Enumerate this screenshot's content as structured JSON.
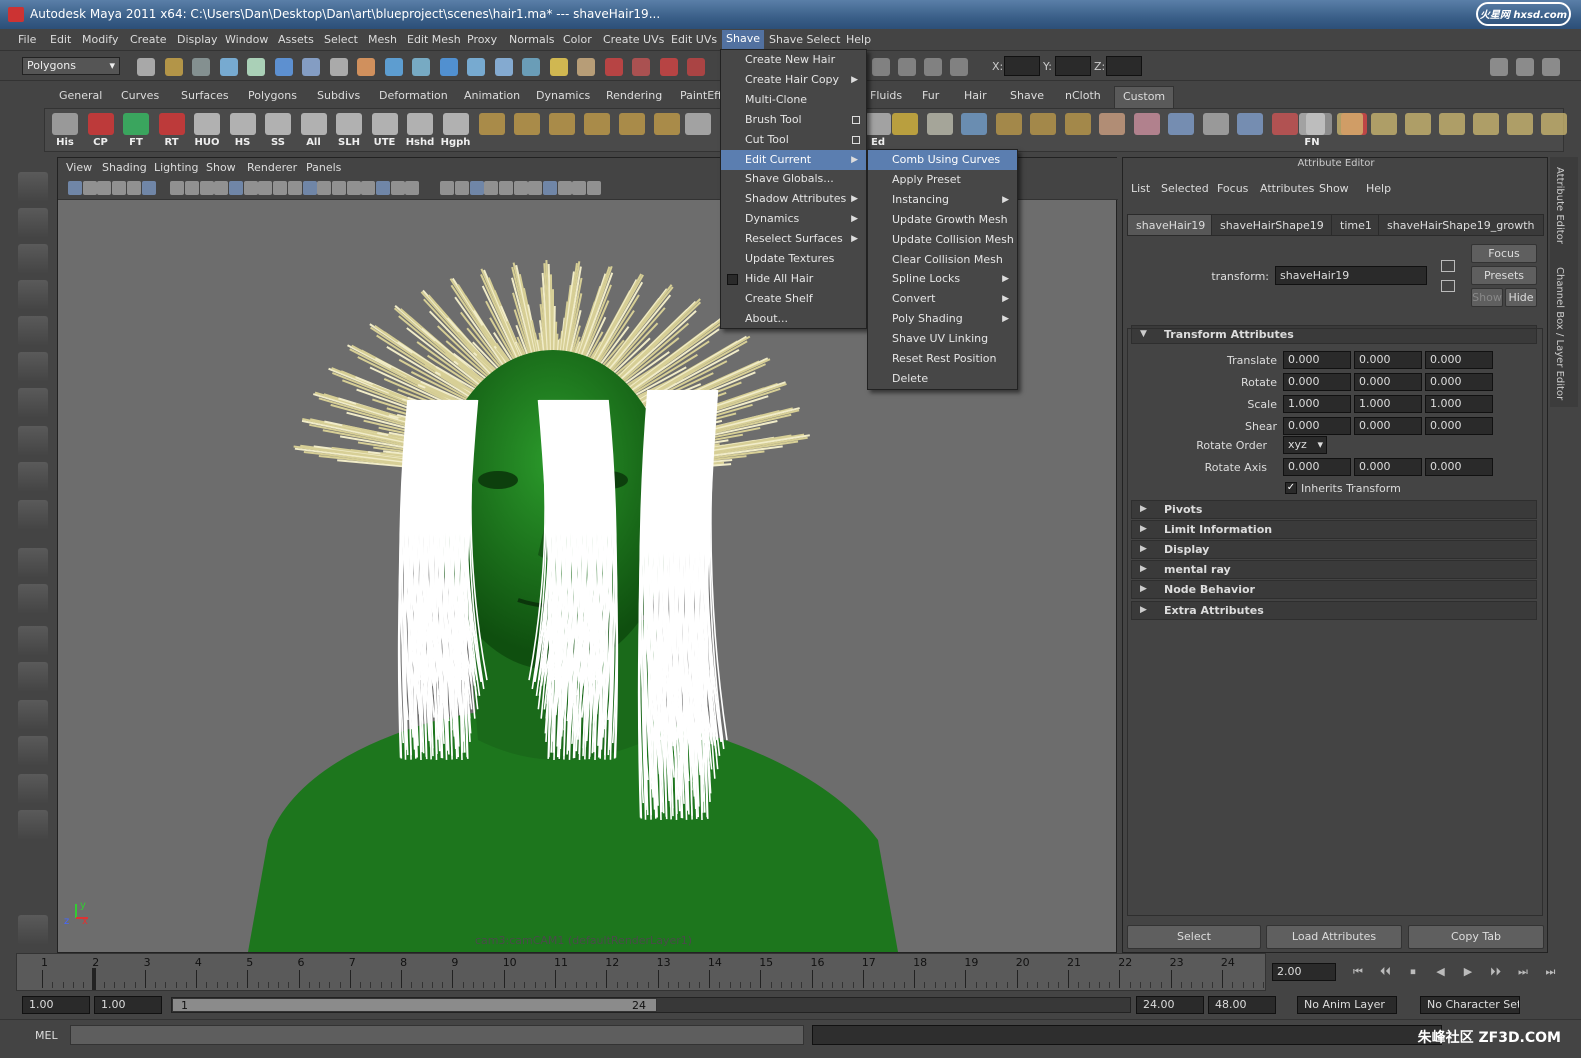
{
  "window": {
    "title": "Autodesk Maya 2011 x64: C:\\Users\\Dan\\Desktop\\Dan\\art\\blueproject\\scenes\\hair1.ma*   ---   shaveHair19...",
    "watermark_top": "火星网 hxsd.com"
  },
  "menubar": [
    "File",
    "Edit",
    "Modify",
    "Create",
    "Display",
    "Window",
    "Assets",
    "Select",
    "Mesh",
    "Edit Mesh",
    "Proxy",
    "Normals",
    "Color",
    "Create UVs",
    "Edit UVs",
    "Shave",
    "Shave Select",
    "Help"
  ],
  "statusline": {
    "menu_set": "Polygons",
    "x_label": "X:",
    "y_label": "Y:",
    "z_label": "Z:"
  },
  "shelf_tabs": [
    "General",
    "Curves",
    "Surfaces",
    "Polygons",
    "Subdivs",
    "Deformation",
    "Animation",
    "Dynamics",
    "Rendering",
    "PaintEff",
    "Fluids",
    "Fur",
    "Hair",
    "Shave",
    "nCloth",
    "Custom"
  ],
  "shelf_buttons": [
    "His",
    "CP",
    "FT",
    "RT",
    "HUO",
    "HS",
    "SS",
    "All",
    "SLH",
    "UTE",
    "Hshd",
    "Hgph"
  ],
  "shelf_right_labels": [
    "Ed",
    "FN"
  ],
  "viewport": {
    "menus": [
      "View",
      "Shading",
      "Lighting",
      "Show",
      "Renderer",
      "Panels"
    ],
    "camera_label": "cam3:camCAM1 (defaultRenderLayer1)",
    "axis_y": "y",
    "axis_z": "z",
    "axis_x": "x"
  },
  "shave_menu": [
    {
      "label": "Create New Hair"
    },
    {
      "label": "Create Hair Copy",
      "arrow": true
    },
    {
      "label": "Multi-Clone"
    },
    {
      "label": "Brush Tool",
      "box": true
    },
    {
      "label": "Cut Tool",
      "box": true
    },
    {
      "label": "Edit Current",
      "arrow": true,
      "highlight": true
    },
    {
      "label": "Shave Globals..."
    },
    {
      "label": "Shadow Attributes",
      "arrow": true
    },
    {
      "label": "Dynamics",
      "arrow": true
    },
    {
      "label": "Reselect Surfaces",
      "arrow": true
    },
    {
      "label": "Update Textures"
    },
    {
      "label": "Hide All Hair",
      "check": true
    },
    {
      "label": "Create Shelf"
    },
    {
      "label": "About..."
    }
  ],
  "edit_current_menu": [
    {
      "label": "Comb Using Curves",
      "highlight": true
    },
    {
      "label": "Apply Preset"
    },
    {
      "label": "Instancing",
      "arrow": true
    },
    {
      "label": "Update Growth Mesh"
    },
    {
      "label": "Update Collision Mesh"
    },
    {
      "label": "Clear Collision Mesh"
    },
    {
      "label": "Spline Locks",
      "arrow": true
    },
    {
      "label": "Convert",
      "arrow": true
    },
    {
      "label": "Poly Shading",
      "arrow": true
    },
    {
      "label": "Shave UV Linking"
    },
    {
      "label": "Reset Rest Position"
    },
    {
      "label": "Delete"
    }
  ],
  "attribute_editor": {
    "title": "Attribute Editor",
    "menus": [
      "List",
      "Selected",
      "Focus",
      "Attributes",
      "Show",
      "Help"
    ],
    "tabs": [
      "shaveHair19",
      "shaveHairShape19",
      "time1",
      "shaveHairShape19_growth"
    ],
    "buttons": {
      "focus": "Focus",
      "presets": "Presets",
      "show": "Show",
      "hide": "Hide"
    },
    "transform_label": "transform:",
    "transform_value": "shaveHair19",
    "transform_section": "Transform Attributes",
    "attrs": [
      {
        "label": "Translate",
        "v": [
          "0.000",
          "0.000",
          "0.000"
        ]
      },
      {
        "label": "Rotate",
        "v": [
          "0.000",
          "0.000",
          "0.000"
        ]
      },
      {
        "label": "Scale",
        "v": [
          "1.000",
          "1.000",
          "1.000"
        ]
      },
      {
        "label": "Shear",
        "v": [
          "0.000",
          "0.000",
          "0.000"
        ]
      }
    ],
    "rotate_order_label": "Rotate Order",
    "rotate_order_value": "xyz",
    "rotate_axis_label": "Rotate Axis",
    "rotate_axis": [
      "0.000",
      "0.000",
      "0.000"
    ],
    "inherits_label": "Inherits Transform",
    "sections": [
      "Pivots",
      "Limit Information",
      "Display",
      "mental ray",
      "Node Behavior",
      "Extra Attributes"
    ],
    "bottom_buttons": [
      "Select",
      "Load Attributes",
      "Copy Tab"
    ]
  },
  "side_tabs": [
    "Attribute Editor",
    "Channel Box / Layer Editor"
  ],
  "timeline": {
    "ticks": [
      "1",
      "2",
      "3",
      "4",
      "5",
      "6",
      "7",
      "8",
      "9",
      "10",
      "11",
      "12",
      "13",
      "14",
      "15",
      "16",
      "17",
      "18",
      "19",
      "20",
      "21",
      "22",
      "23",
      "24"
    ],
    "current_frame": "2.00",
    "playback_symbols": [
      "⏮",
      "⏴⏴",
      "⏹",
      "◀",
      "▶",
      "⏵⏵",
      "⏭",
      "⏭"
    ]
  },
  "range": {
    "start": "1.00",
    "start2": "1.00",
    "slider_start": "1",
    "slider_end": "24",
    "end": "24.00",
    "end2": "48.00",
    "anim_layer": "No Anim Layer",
    "character_set": "No Character Set"
  },
  "command_line": {
    "label": "MEL",
    "watermark": "朱峰社区 ZF3D.COM"
  },
  "colors": {
    "menu_highlight": "#5b7eb0",
    "skin": "#1f7a1f",
    "hair_tips": "#e6dfb0"
  }
}
